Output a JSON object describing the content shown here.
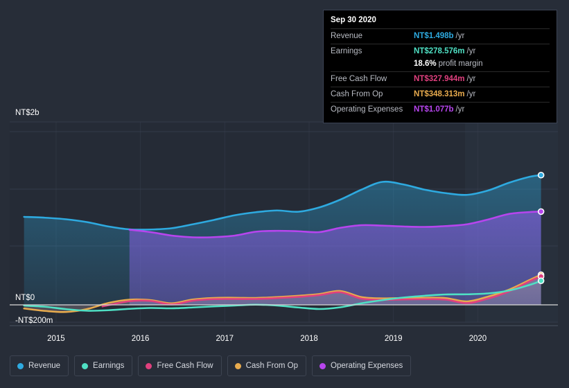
{
  "colors": {
    "background": "#272d38",
    "plot_bg": "#252b36",
    "band_bg": "#2b3442",
    "revenue": "#2eaae0",
    "earnings": "#4fe0c4",
    "free_cash_flow": "#e0407e",
    "cash_from_op": "#e8ab4e",
    "operating_expenses": "#b745ee",
    "zero_line": "#d8d8d8",
    "grid": "#3a4150",
    "axis_text": "#ffffff"
  },
  "tooltip": {
    "date": "Sep 30 2020",
    "rows": [
      {
        "label": "Revenue",
        "value": "NT$1.498b",
        "unit": "/yr",
        "color": "#2eaae0"
      },
      {
        "label": "Earnings",
        "value": "NT$278.576m",
        "unit": "/yr",
        "color": "#4fe0c4"
      },
      {
        "label": "",
        "value": "18.6%",
        "unit": "profit margin",
        "color": "#ffffff",
        "sub": true
      },
      {
        "label": "Free Cash Flow",
        "value": "NT$327.944m",
        "unit": "/yr",
        "color": "#e0407e"
      },
      {
        "label": "Cash From Op",
        "value": "NT$348.313m",
        "unit": "/yr",
        "color": "#e8ab4e"
      },
      {
        "label": "Operating Expenses",
        "value": "NT$1.077b",
        "unit": "/yr",
        "color": "#b745ee"
      }
    ]
  },
  "legend": {
    "items": [
      {
        "label": "Revenue",
        "color": "#2eaae0"
      },
      {
        "label": "Earnings",
        "color": "#4fe0c4"
      },
      {
        "label": "Free Cash Flow",
        "color": "#e0407e"
      },
      {
        "label": "Cash From Op",
        "color": "#e8ab4e"
      },
      {
        "label": "Operating Expenses",
        "color": "#b745ee"
      }
    ]
  },
  "chart_data": {
    "type": "area",
    "title": "",
    "xlabel": "",
    "ylabel": "",
    "currency": "NTD",
    "grid": true,
    "legend_position": "bottom",
    "y_axis": {
      "ticks": [
        {
          "label": "NT$2b",
          "value": 2000
        },
        {
          "label": "NT$0",
          "value": 0
        },
        {
          "label": "-NT$200m",
          "value": -200
        }
      ],
      "ylim": [
        -280,
        2000
      ],
      "unit": "NT$ millions"
    },
    "x_axis": {
      "ticks": [
        "2015",
        "2016",
        "2017",
        "2018",
        "2019",
        "2020"
      ],
      "xlim": [
        "2014.45",
        "2020.95"
      ]
    },
    "series": [
      {
        "name": "Revenue",
        "color": "#2eaae0",
        "x": [
          2014.62,
          2014.87,
          2015.12,
          2015.37,
          2015.62,
          2015.87,
          2016.12,
          2016.37,
          2016.62,
          2016.87,
          2017.12,
          2017.37,
          2017.62,
          2017.87,
          2018.12,
          2018.37,
          2018.62,
          2018.87,
          2019.12,
          2019.37,
          2019.62,
          2019.87,
          2020.12,
          2020.37,
          2020.62,
          2020.75
        ],
        "values": [
          1016,
          1006,
          988,
          955,
          905,
          872,
          870,
          885,
          930,
          980,
          1035,
          1070,
          1090,
          1075,
          1125,
          1215,
          1330,
          1420,
          1390,
          1330,
          1290,
          1270,
          1320,
          1410,
          1480,
          1498
        ]
      },
      {
        "name": "Operating Expenses",
        "color": "#b745ee",
        "x": [
          2015.87,
          2016.12,
          2016.37,
          2016.62,
          2016.87,
          2017.12,
          2017.37,
          2017.62,
          2017.87,
          2018.12,
          2018.37,
          2018.62,
          2018.87,
          2019.12,
          2019.37,
          2019.62,
          2019.87,
          2020.12,
          2020.37,
          2020.62,
          2020.75
        ],
        "values": [
          868,
          840,
          800,
          780,
          782,
          800,
          845,
          855,
          850,
          840,
          890,
          920,
          915,
          905,
          900,
          910,
          930,
          985,
          1050,
          1072,
          1077
        ]
      },
      {
        "name": "Cash From Op",
        "color": "#e8ab4e",
        "x": [
          2014.62,
          2014.87,
          2015.12,
          2015.37,
          2015.62,
          2015.87,
          2016.12,
          2016.37,
          2016.62,
          2016.87,
          2017.12,
          2017.37,
          2017.62,
          2017.87,
          2018.12,
          2018.37,
          2018.62,
          2018.87,
          2019.12,
          2019.37,
          2019.62,
          2019.87,
          2020.12,
          2020.37,
          2020.62,
          2020.75
        ],
        "values": [
          -42,
          -70,
          -82,
          -48,
          22,
          60,
          55,
          18,
          62,
          80,
          82,
          80,
          90,
          105,
          125,
          160,
          90,
          75,
          80,
          82,
          78,
          40,
          95,
          175,
          290,
          348
        ]
      },
      {
        "name": "Free Cash Flow",
        "color": "#e0407e",
        "x": [
          2015.55,
          2015.87,
          2016.12,
          2016.37,
          2016.62,
          2016.87,
          2017.12,
          2017.37,
          2017.62,
          2017.87,
          2018.12,
          2018.37,
          2018.62,
          2018.87,
          2019.12,
          2019.37,
          2019.62,
          2019.87,
          2020.12,
          2020.37,
          2020.62,
          2020.75
        ],
        "values": [
          -18,
          42,
          45,
          5,
          48,
          66,
          68,
          68,
          78,
          92,
          112,
          145,
          72,
          58,
          62,
          65,
          60,
          20,
          72,
          155,
          275,
          328
        ]
      },
      {
        "name": "Earnings",
        "color": "#4fe0c4",
        "x": [
          2014.62,
          2014.87,
          2015.12,
          2015.37,
          2015.62,
          2015.87,
          2016.12,
          2016.37,
          2016.62,
          2016.87,
          2017.12,
          2017.37,
          2017.62,
          2017.87,
          2018.12,
          2018.37,
          2018.62,
          2018.87,
          2019.12,
          2019.37,
          2019.62,
          2019.87,
          2020.12,
          2020.37,
          2020.62,
          2020.75
        ],
        "values": [
          -8,
          -22,
          -50,
          -68,
          -62,
          -46,
          -36,
          -40,
          -30,
          -18,
          -8,
          2,
          -8,
          -30,
          -48,
          -28,
          18,
          55,
          85,
          105,
          120,
          122,
          132,
          165,
          232,
          278
        ]
      }
    ],
    "highlight_band": {
      "from": "2019.85",
      "to": "2020.95"
    },
    "end_markers": [
      {
        "series": "Revenue",
        "value": 1498
      },
      {
        "series": "Operating Expenses",
        "value": 1077
      },
      {
        "series": "Cash From Op",
        "value": 348
      },
      {
        "series": "Free Cash Flow",
        "value": 328
      },
      {
        "series": "Earnings",
        "value": 278
      }
    ]
  }
}
